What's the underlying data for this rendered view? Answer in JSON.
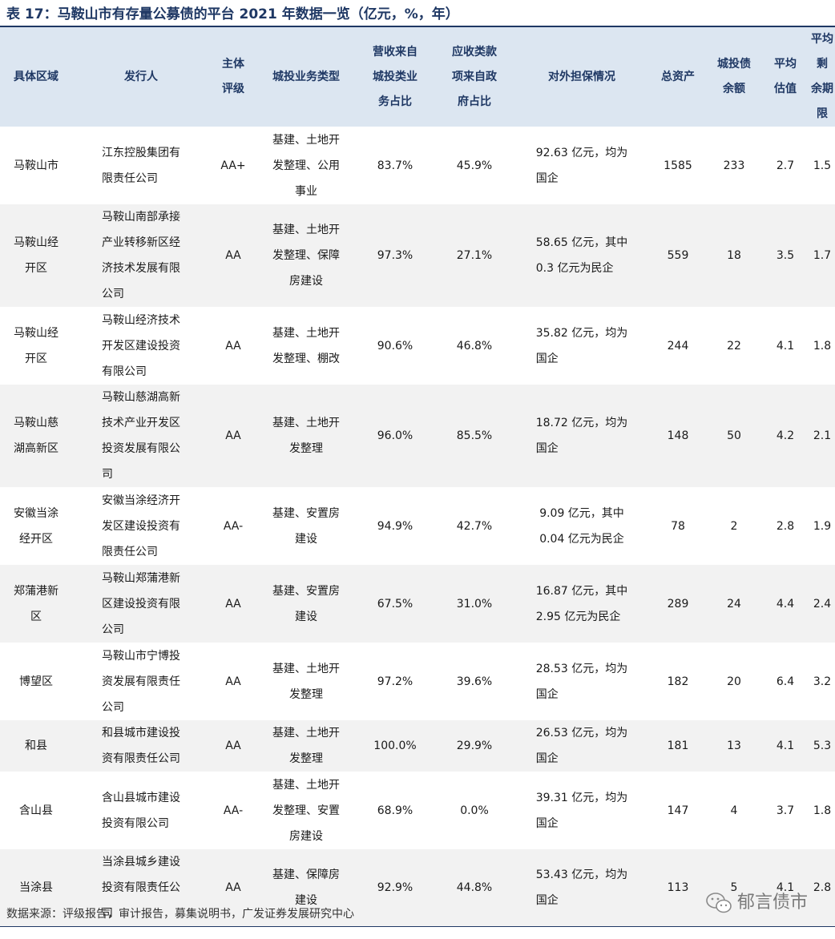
{
  "title": "表 17：马鞍山市有存量公募债的平台 2021 年数据一览（亿元，%，年）",
  "headers": [
    "具体区域",
    "发行人",
    "主体\n评级",
    "城投业务类型",
    "营收来自\n城投类业\n务占比",
    "应收类款\n项来自政\n府占比",
    "对外担保情况",
    "总资产",
    "城投债\n余额",
    "平均\n估值",
    "平均剩\n余期限"
  ],
  "rows": [
    {
      "region": "马鞍山市",
      "issuer": "江东控股集团有\n限责任公司",
      "rating": "AA+",
      "business": "基建、土地开\n发整理、公用\n事业",
      "revenue_share": "83.7%",
      "receivable_share": "45.9%",
      "guarantee": "92.63 亿元，均为\n国企",
      "total_assets": "1585",
      "bond_balance": "233",
      "avg_valuation": "2.7",
      "avg_maturity": "1.5"
    },
    {
      "region": "马鞍山经\n开区",
      "issuer": "马鞍山南部承接\n产业转移新区经\n济技术发展有限\n公司",
      "rating": "AA",
      "business": "基建、土地开\n发整理、保障\n房建设",
      "revenue_share": "97.3%",
      "receivable_share": "27.1%",
      "guarantee": "58.65 亿元，其中\n0.3 亿元为民企",
      "total_assets": "559",
      "bond_balance": "18",
      "avg_valuation": "3.5",
      "avg_maturity": "1.7"
    },
    {
      "region": "马鞍山经\n开区",
      "issuer": "马鞍山经济技术\n开发区建设投资\n有限公司",
      "rating": "AA",
      "business": "基建、土地开\n发整理、棚改",
      "revenue_share": "90.6%",
      "receivable_share": "46.8%",
      "guarantee": "35.82 亿元，均为\n国企",
      "total_assets": "244",
      "bond_balance": "22",
      "avg_valuation": "4.1",
      "avg_maturity": "1.8"
    },
    {
      "region": "马鞍山慈\n湖高新区",
      "issuer": "马鞍山慈湖高新\n技术产业开发区\n投资发展有限公\n司",
      "rating": "AA",
      "business": "基建、土地开\n发整理",
      "revenue_share": "96.0%",
      "receivable_share": "85.5%",
      "guarantee": "18.72 亿元，均为\n国企",
      "total_assets": "148",
      "bond_balance": "50",
      "avg_valuation": "4.2",
      "avg_maturity": "2.1"
    },
    {
      "region": "安徽当涂\n经开区",
      "issuer": "安徽当涂经济开\n发区建设投资有\n限责任公司",
      "rating": "AA-",
      "business": "基建、安置房\n建设",
      "revenue_share": "94.9%",
      "receivable_share": "42.7%",
      "guarantee": "9.09 亿元，其中\n0.04 亿元为民企",
      "total_assets": "78",
      "bond_balance": "2",
      "avg_valuation": "2.8",
      "avg_maturity": "1.9"
    },
    {
      "region": "郑蒲港新\n区",
      "issuer": "马鞍山郑蒲港新\n区建设投资有限\n公司",
      "rating": "AA",
      "business": "基建、安置房\n建设",
      "revenue_share": "67.5%",
      "receivable_share": "31.0%",
      "guarantee": "16.87 亿元，其中\n2.95 亿元为民企",
      "total_assets": "289",
      "bond_balance": "24",
      "avg_valuation": "4.4",
      "avg_maturity": "2.4"
    },
    {
      "region": "博望区",
      "issuer": "马鞍山市宁博投\n资发展有限责任\n公司",
      "rating": "AA",
      "business": "基建、土地开\n发整理",
      "revenue_share": "97.2%",
      "receivable_share": "39.6%",
      "guarantee": "28.53 亿元，均为\n国企",
      "total_assets": "182",
      "bond_balance": "20",
      "avg_valuation": "6.4",
      "avg_maturity": "3.2"
    },
    {
      "region": "和县",
      "issuer": "和县城市建设投\n资有限责任公司",
      "rating": "AA",
      "business": "基建、土地开\n发整理",
      "revenue_share": "100.0%",
      "receivable_share": "29.9%",
      "guarantee": "26.53 亿元，均为\n国企",
      "total_assets": "181",
      "bond_balance": "13",
      "avg_valuation": "4.1",
      "avg_maturity": "5.3"
    },
    {
      "region": "含山县",
      "issuer": "含山县城市建设\n投资有限公司",
      "rating": "AA-",
      "business": "基建、土地开\n发整理、安置\n房建设",
      "revenue_share": "68.9%",
      "receivable_share": "0.0%",
      "guarantee": "39.31 亿元，均为\n国企",
      "total_assets": "147",
      "bond_balance": "4",
      "avg_valuation": "3.7",
      "avg_maturity": "1.8"
    },
    {
      "region": "当涂县",
      "issuer": "当涂县城乡建设\n投资有限责任公\n司",
      "rating": "AA",
      "business": "基建、保障房\n建设",
      "revenue_share": "92.9%",
      "receivable_share": "44.8%",
      "guarantee": "53.43 亿元，均为\n国企",
      "total_assets": "113",
      "bond_balance": "5",
      "avg_valuation": "4.1",
      "avg_maturity": "2.8"
    }
  ],
  "source_note": "数据来源：评级报告，审计报告，募集说明书，广发证券发展研究中心",
  "watermark": {
    "icon": "wechat-icon",
    "text": "郁言债市"
  }
}
